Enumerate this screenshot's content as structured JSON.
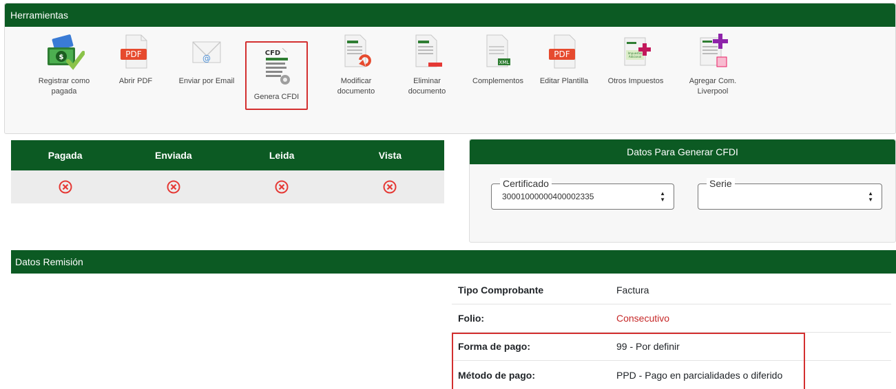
{
  "tools": {
    "title": "Herramientas",
    "items": [
      {
        "label": "Registrar como pagada"
      },
      {
        "label": "Abrir PDF"
      },
      {
        "label": "Enviar por Email"
      },
      {
        "label": "Genera CFDI"
      },
      {
        "label": "Modificar documento"
      },
      {
        "label": "Eliminar documento"
      },
      {
        "label": "Complementos"
      },
      {
        "label": "Editar Plantilla"
      },
      {
        "label": "Otros Impuestos"
      },
      {
        "label": "Agregar Com. Liverpool"
      }
    ],
    "icon_texts": {
      "pdf": "PDF",
      "cfd": "CFD",
      "xml": "XML",
      "impuestos": "Impuestos Adicional"
    }
  },
  "status": {
    "headers": [
      "Pagada",
      "Enviada",
      "Leida",
      "Vista"
    ]
  },
  "cfdi": {
    "title": "Datos Para Generar CFDI",
    "certificado_label": "Certificado",
    "certificado_value": "30001000000400002335",
    "serie_label": "Serie",
    "serie_value": ""
  },
  "remision": {
    "title": "Datos Remisión",
    "rows": [
      {
        "label": "Tipo Comprobante",
        "value": "Factura"
      },
      {
        "label": "Folio:",
        "value": "Consecutivo"
      },
      {
        "label": "Forma de pago:",
        "value": "99 - Por definir"
      },
      {
        "label": "Método de pago:",
        "value": "PPD - Pago en parcialidades o diferido"
      }
    ]
  },
  "colors": {
    "header_green": "#0c5a23",
    "highlight_red": "#d32f2f",
    "status_x_red": "#e53935"
  }
}
